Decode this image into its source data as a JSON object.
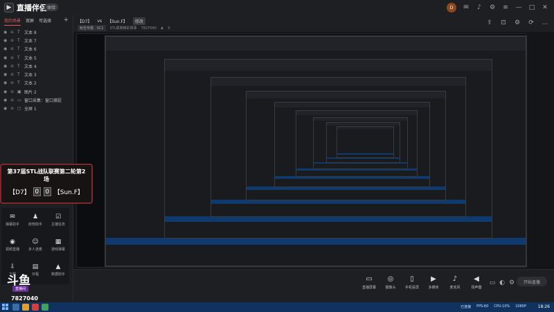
{
  "app": {
    "name": "直播伴侣",
    "version_badge": "体验"
  },
  "sidebar": {
    "tabs": [
      "我的场景",
      "双屏",
      "可选择"
    ],
    "layers": [
      {
        "icon": "text-icon",
        "label": "文本 8"
      },
      {
        "icon": "text-icon",
        "label": "文本 7"
      },
      {
        "icon": "text-icon",
        "label": "文本 6"
      },
      {
        "icon": "text-icon",
        "label": "文本 5"
      },
      {
        "icon": "text-icon",
        "label": "文本 4"
      },
      {
        "icon": "text-icon",
        "label": "文本 3"
      },
      {
        "icon": "text-icon",
        "label": "文本 2"
      },
      {
        "icon": "image-icon",
        "label": "图片 2"
      },
      {
        "icon": "window-icon",
        "label": "窗口采集：窗口捕捉"
      },
      {
        "icon": "screen-icon",
        "label": "全屏 1"
      }
    ]
  },
  "header": {
    "team_left": "【D7】",
    "vs": "vs",
    "team_right": "【Sun.F】",
    "edit_tag": "修改",
    "category": "射击专题 · SC1",
    "stream_name": "STL联赛精彩赛事",
    "room_id": "7827040",
    "viewers": "0"
  },
  "overlay": {
    "title": "第37届STL战队联赛第二轮第2场",
    "team_left": "【D7】",
    "score_left": "0",
    "score_right": "0",
    "team_right": "【Sun.F】"
  },
  "left_tools": [
    {
      "icon": "gift-icon",
      "label": "弹幕助手"
    },
    {
      "icon": "user-icon",
      "label": "房管助手"
    },
    {
      "icon": "task-icon",
      "label": "主播任务"
    },
    {
      "icon": "video-icon",
      "label": "视频直播"
    },
    {
      "icon": "pk-icon",
      "label": "多人连麦"
    },
    {
      "icon": "game-icon",
      "label": "游戏弹幕"
    },
    {
      "icon": "download-icon",
      "label": "下载"
    },
    {
      "icon": "calendar-icon",
      "label": "日程"
    },
    {
      "icon": "data-icon",
      "label": "数据助手"
    }
  ],
  "branding": {
    "logo_text": "斗鱼",
    "badge": "直播间",
    "room": "7827040"
  },
  "bottom_toolbar": [
    {
      "icon": "screen-share-icon",
      "label": "直播屏幕"
    },
    {
      "icon": "camera-icon",
      "label": "摄像头"
    },
    {
      "icon": "phone-icon",
      "label": "手机投屏"
    },
    {
      "icon": "media-icon",
      "label": "多媒体"
    },
    {
      "icon": "mic-icon",
      "label": "麦克风"
    },
    {
      "icon": "speaker-icon",
      "label": "扬声器"
    }
  ],
  "live_button": "开始直播",
  "taskbar": {
    "clock": "18:26",
    "tray": [
      "已连接",
      "FPS:60",
      "CPU:10%",
      "1080P"
    ]
  }
}
